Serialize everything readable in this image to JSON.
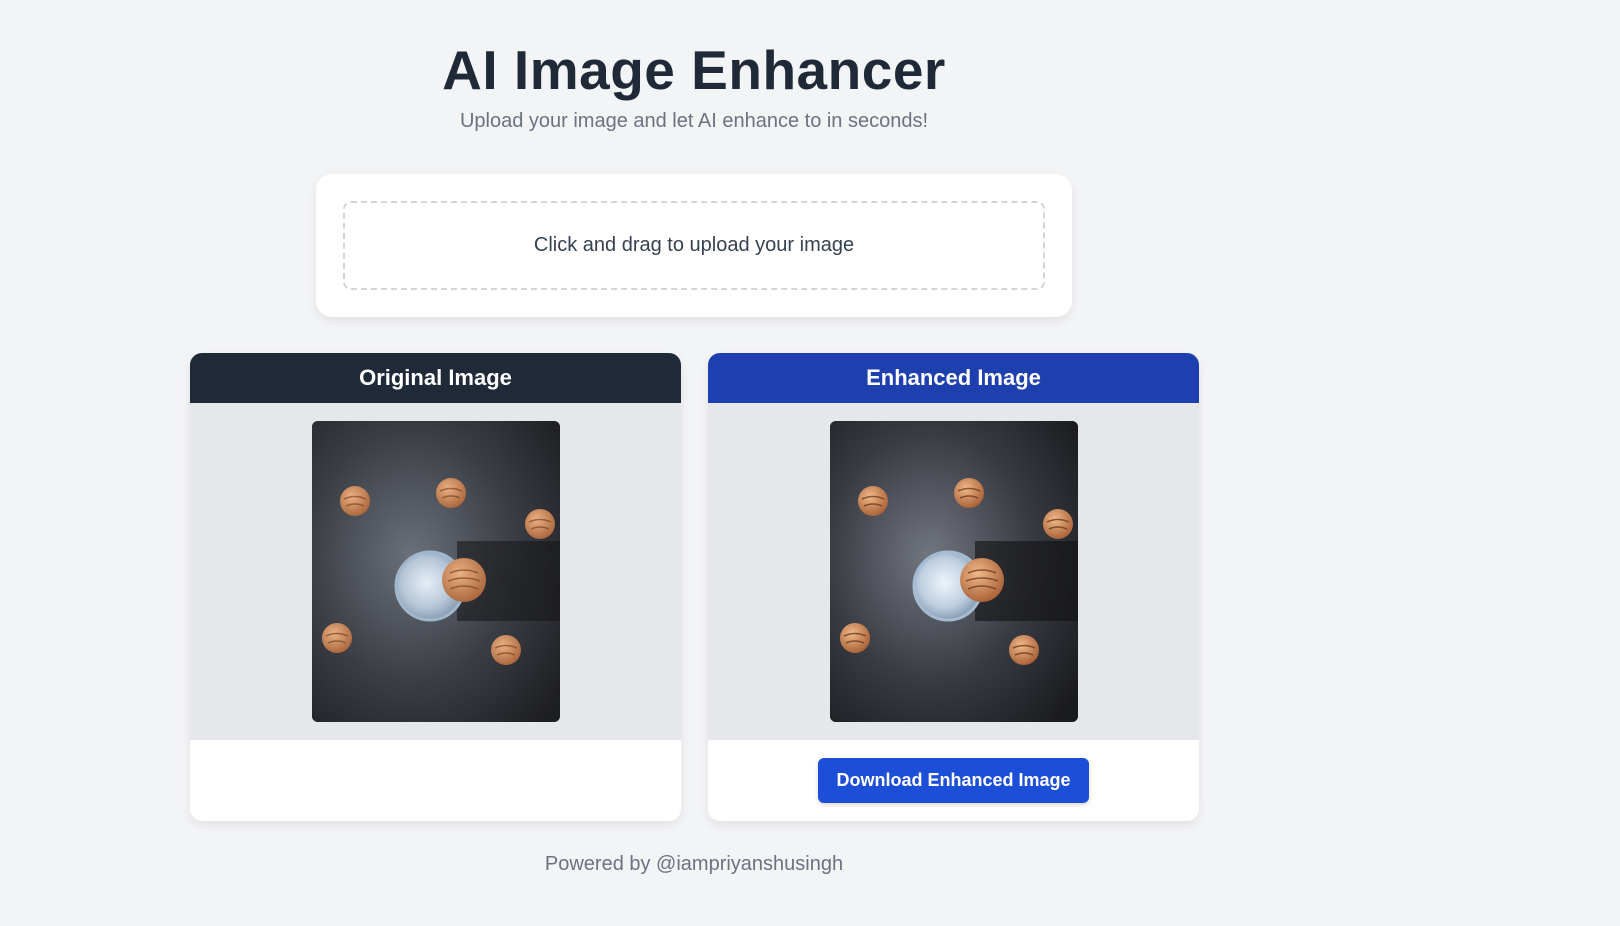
{
  "header": {
    "title": "AI Image Enhancer",
    "subtitle": "Upload your image and let AI enhance to in seconds!"
  },
  "upload": {
    "label": "Click and drag to upload your image"
  },
  "panels": {
    "original": {
      "title": "Original Image",
      "color": "#1f2937"
    },
    "enhanced": {
      "title": "Enhanced Image",
      "color": "#1e40af",
      "download_label": "Download Enhanced Image"
    }
  },
  "footer": {
    "text": "Powered by @iampriyanshusingh"
  },
  "colors": {
    "background": "#f3f4f6",
    "accent": "#1d4ed8"
  }
}
